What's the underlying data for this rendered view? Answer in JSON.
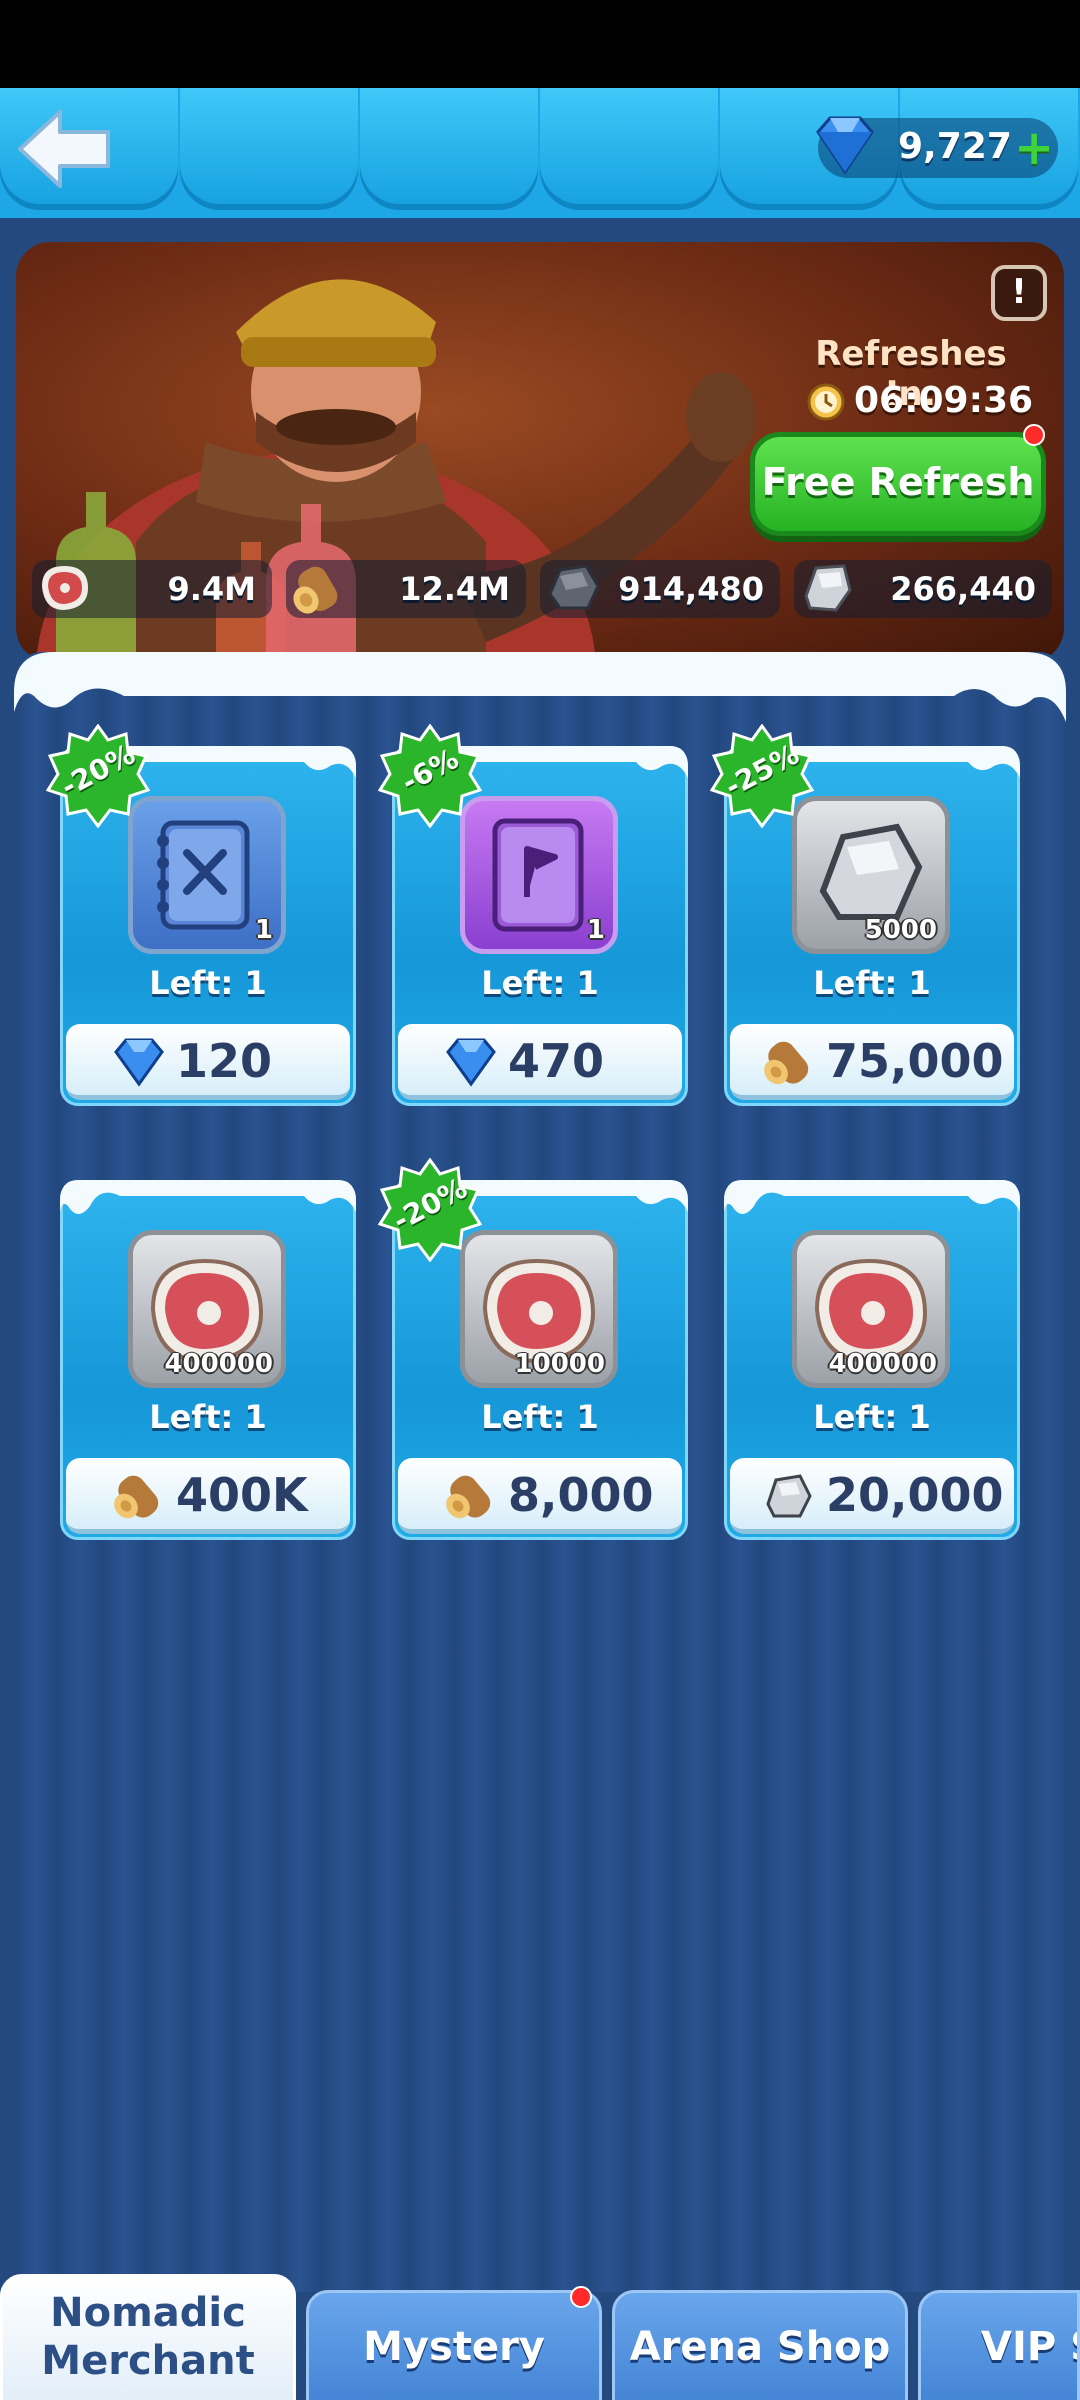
{
  "header": {
    "gems": "9,727"
  },
  "banner": {
    "refresh_label": "Refreshes In:",
    "timer": "06:09:36",
    "free_refresh_label": "Free Refresh",
    "info_label": "!",
    "resources": [
      {
        "icon": "meat-icon",
        "value": "9.4M"
      },
      {
        "icon": "wood-log-icon",
        "value": "12.4M"
      },
      {
        "icon": "ore-icon",
        "value": "914,480"
      },
      {
        "icon": "iron-icon",
        "value": "266,440"
      }
    ]
  },
  "items": [
    {
      "discount": "-20%",
      "item": "blue-tome-icon",
      "qty": "1",
      "left": "Left: 1",
      "currency": "gem-icon",
      "price": "120"
    },
    {
      "discount": "-6%",
      "item": "purple-tome-icon",
      "qty": "1",
      "left": "Left: 1",
      "currency": "gem-icon",
      "price": "470"
    },
    {
      "discount": "-25%",
      "item": "iron-icon",
      "qty": "5000",
      "left": "Left: 1",
      "currency": "wood-log-icon",
      "price": "75,000"
    },
    {
      "discount": "",
      "item": "meat-icon",
      "qty": "400000",
      "left": "Left: 1",
      "currency": "wood-log-icon",
      "price": "400K"
    },
    {
      "discount": "-20%",
      "item": "meat-icon",
      "qty": "10000",
      "left": "Left: 1",
      "currency": "wood-log-icon",
      "price": "8,000"
    },
    {
      "discount": "",
      "item": "meat-icon",
      "qty": "400000",
      "left": "Left: 1",
      "currency": "iron-icon",
      "price": "20,000"
    }
  ],
  "tabs": [
    {
      "line1": "Nomadic",
      "line2": "Merchant",
      "active": true
    },
    {
      "label": "Mystery Shop"
    },
    {
      "label": "Arena Shop"
    },
    {
      "label": "VIP S"
    }
  ],
  "colors": {
    "accent_green": "#3fd23a",
    "discount_green": "#2ab52a",
    "notification_red": "#ff2a2a"
  }
}
